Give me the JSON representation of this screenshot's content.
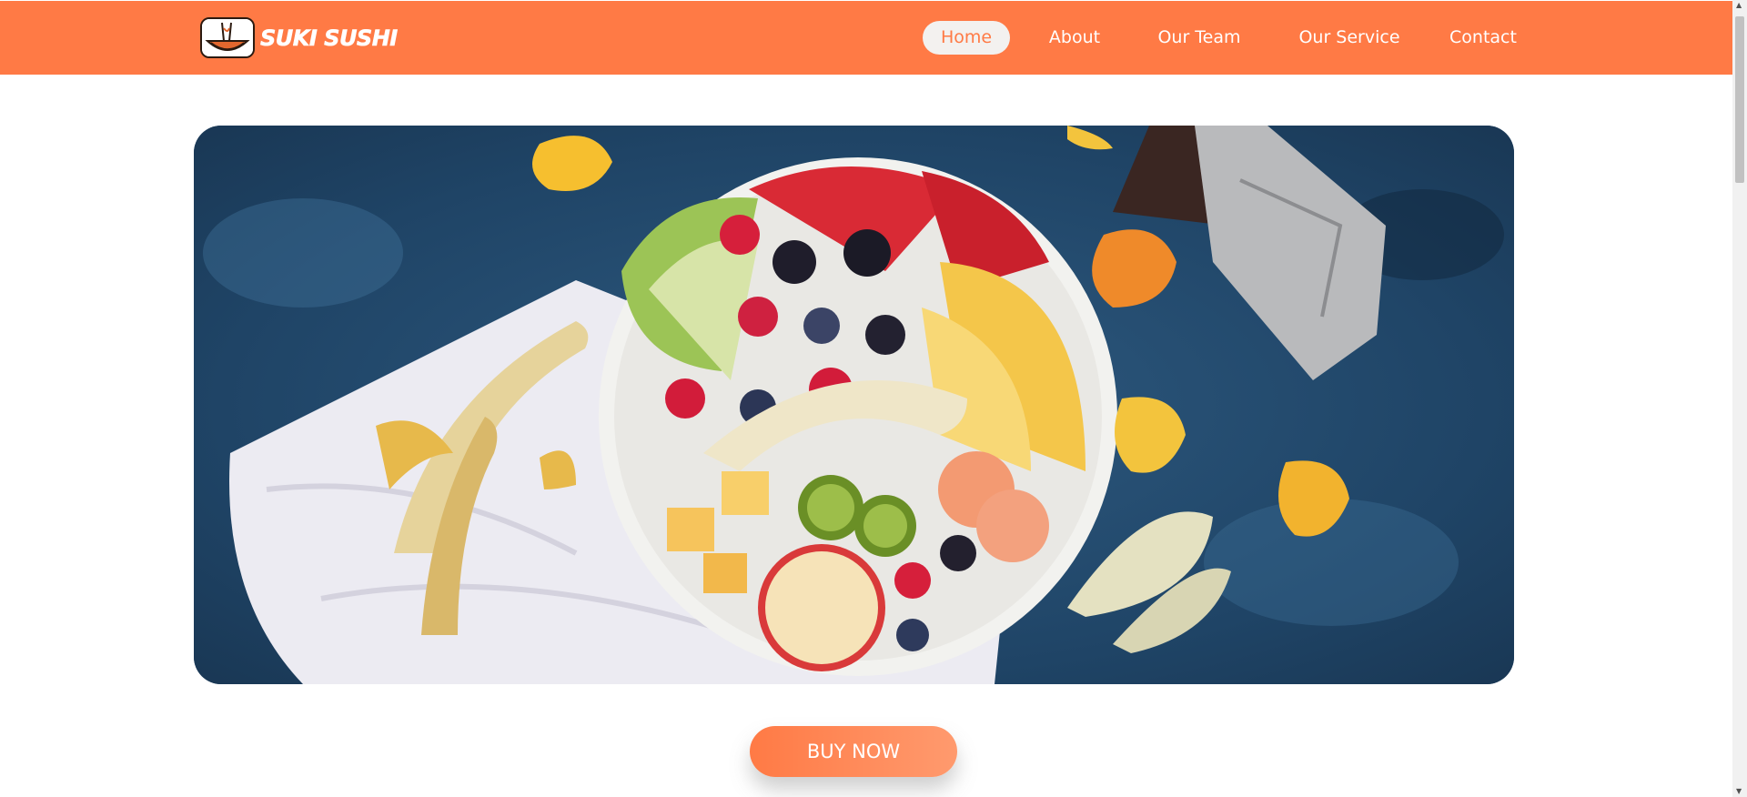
{
  "brand": {
    "name": "SUKI SUSHI"
  },
  "nav": {
    "items": [
      {
        "label": "Home",
        "active": true
      },
      {
        "label": "About",
        "active": false
      },
      {
        "label": "Our Team",
        "active": false
      },
      {
        "label": "Our Service",
        "active": false
      },
      {
        "label": "Contact",
        "active": false
      }
    ]
  },
  "hero": {
    "image": "fruit-platter-photo"
  },
  "cta": {
    "label": "BUY NOW"
  },
  "colors": {
    "accent": "#ff7a45",
    "active_pill": "#f3f1ef",
    "background": "#ffffff"
  }
}
